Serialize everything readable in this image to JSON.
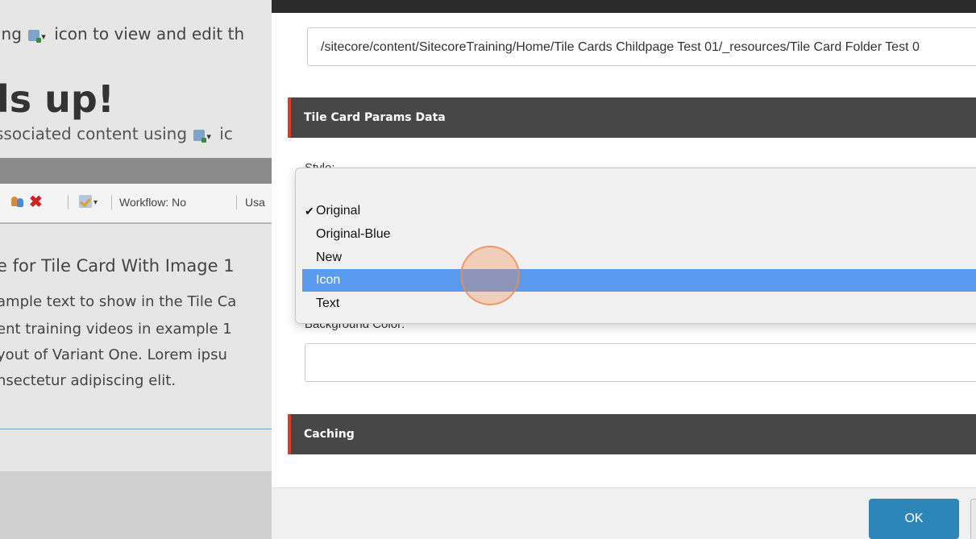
{
  "background_page": {
    "line1_before": "ing",
    "line1_after": "icon to view and edit th",
    "heading": "ls up!",
    "subline": "ssociated content using",
    "subline_tail": "ic",
    "toolbar": {
      "workflow": "Workflow: No",
      "usage": "Usa"
    },
    "card_title": "e for Tile Card With Image 1",
    "body_lines": [
      "ample text to show in the Tile Ca",
      "ent training videos in example 1",
      "yout of Variant One. Lorem ipsu",
      "nsectetur adipiscing elit."
    ]
  },
  "dialog": {
    "path_value": "/sitecore/content/SitecoreTraining/Home/Tile Cards Childpage Test 01/_resources/Tile Card Folder Test 0",
    "section_params": "Tile Card Params Data",
    "style_label": "Style:",
    "background_color_label": "Background Color:",
    "section_caching": "Caching",
    "ok_label": "OK"
  },
  "dropdown": {
    "selected": "Original",
    "highlighted": "Icon",
    "options": [
      "Original",
      "Original-Blue",
      "New",
      "Icon",
      "Text"
    ]
  },
  "colors": {
    "accent": "#d63b2e",
    "section_bar": "#474747",
    "highlight": "#5a9bf0",
    "ok_button": "#2e86b8"
  }
}
